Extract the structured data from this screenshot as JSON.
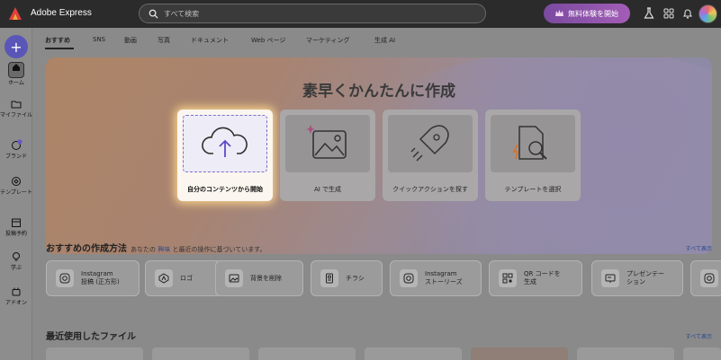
{
  "app": {
    "title": "Adobe Express"
  },
  "search": {
    "placeholder": "すべて検索"
  },
  "header": {
    "trial_label": "無料体験を開始"
  },
  "rail": {
    "items": [
      {
        "label": "ホーム",
        "icon": "home-icon"
      },
      {
        "label": "マイファイル",
        "icon": "folder-icon"
      },
      {
        "label": "ブランド",
        "icon": "brand-icon"
      },
      {
        "label": "テンプレート",
        "icon": "template-icon"
      },
      {
        "label": "投稿予約",
        "icon": "calendar-icon"
      },
      {
        "label": "学ぶ",
        "icon": "lightbulb-icon"
      },
      {
        "label": "アドオン",
        "icon": "addon-icon"
      }
    ]
  },
  "tabs": [
    "おすすめ",
    "SNS",
    "動画",
    "写真",
    "ドキュメント",
    "Web ページ",
    "マーケティング",
    "生成 AI"
  ],
  "hero": {
    "title": "素早くかんたんに作成",
    "cards": [
      {
        "label": "自分のコンテンツから開始",
        "icon": "upload-cloud-icon"
      },
      {
        "label": "AI で生成",
        "icon": "ai-image-icon"
      },
      {
        "label": "クイックアクションを探す",
        "icon": "rocket-icon"
      },
      {
        "label": "テンプレートを選択",
        "icon": "template-search-icon"
      }
    ]
  },
  "recommend": {
    "title": "おすすめの作成方法",
    "sub_before": "あなたの",
    "sub_keyword": "興味",
    "sub_after": "と最近の操作に基づいています。",
    "see_all": "すべて表示",
    "items": [
      {
        "line1": "Instagram",
        "line2": "投稿 (正方形)",
        "icon": "instagram-icon"
      },
      {
        "line1": "ロゴ",
        "line2": "",
        "icon": "logo-icon"
      },
      {
        "line1": "背景を削除",
        "line2": "",
        "icon": "remove-bg-icon"
      },
      {
        "line1": "チラシ",
        "line2": "",
        "icon": "flyer-icon"
      },
      {
        "line1": "Instagram",
        "line2": "ストーリーズ",
        "icon": "instagram-icon"
      },
      {
        "line1": "QR コードを",
        "line2": "生成",
        "icon": "qr-code-icon"
      },
      {
        "line1": "プレゼンテー",
        "line2": "ション",
        "icon": "presentation-icon"
      },
      {
        "line1": "",
        "line2": "",
        "icon": "instagram-icon"
      }
    ]
  },
  "recent": {
    "title": "最近使用したファイル",
    "see_all": "すべて表示"
  }
}
